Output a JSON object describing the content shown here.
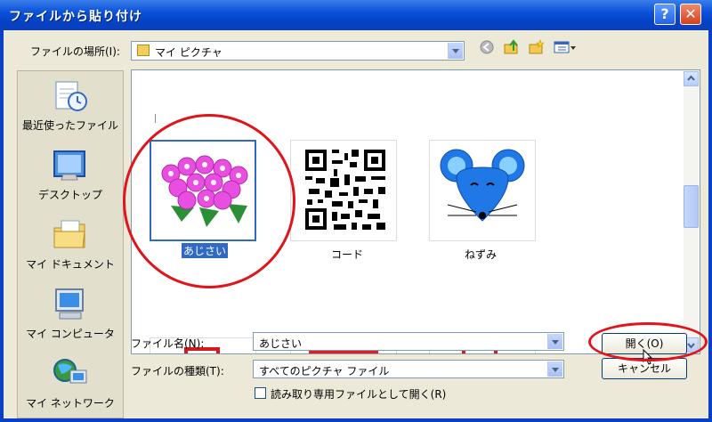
{
  "window": {
    "title": "ファイルから貼り付け",
    "help_glyph": "?",
    "close_glyph": "✕"
  },
  "location": {
    "label": "ファイルの場所(I):",
    "value": "マイ ピクチャ"
  },
  "places": [
    {
      "label": "最近使ったファイル",
      "icon": "recent-files-icon"
    },
    {
      "label": "デスクトップ",
      "icon": "desktop-icon"
    },
    {
      "label": "マイ ドキュメント",
      "icon": "my-documents-icon"
    },
    {
      "label": "マイ コンピュータ",
      "icon": "my-computer-icon"
    },
    {
      "label": "マイ ネットワーク",
      "icon": "my-network-icon"
    }
  ],
  "files": [
    {
      "name": "あじさい",
      "selected": true
    },
    {
      "name": "コード",
      "selected": false
    },
    {
      "name": "ねずみ",
      "selected": false
    }
  ],
  "filename": {
    "label": "ファイル名(N):",
    "value": "あじさい"
  },
  "filetype": {
    "label": "ファイルの種類(T):",
    "value": "すべてのピクチャ ファイル"
  },
  "readonly": {
    "label": "読み取り専用ファイルとして開く(R)"
  },
  "buttons": {
    "open": "開く(O)",
    "cancel": "キャンセル"
  },
  "colors": {
    "accent": "#316ac5",
    "highlight_ring": "#e0141b",
    "title_bar": "#0a52d8"
  }
}
